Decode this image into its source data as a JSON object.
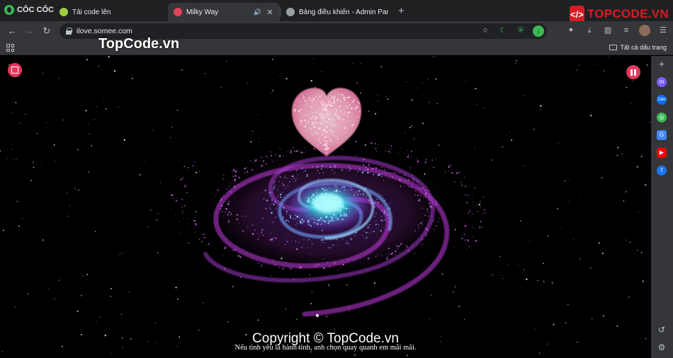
{
  "browser": {
    "brand": "CỐC CỐC",
    "tabs": [
      {
        "title": "Tải code lên",
        "favicon_color": "#9bcf3b"
      },
      {
        "title": "Milky Way",
        "favicon_color": "#e2435a",
        "active": true
      },
      {
        "title": "Bảng điều khiển - Admin Panel",
        "favicon_color": "#9aa0a6"
      }
    ],
    "url": "ilove.somee.com",
    "bookmarks_label": "Tất cả dấu trang",
    "topcode_logo": "TOPCODE.VN"
  },
  "page": {
    "watermark_top": "TopCode.vn",
    "copyright": "Copyright © TopCode.vn",
    "caption": "Nếu tình yêu là hành tinh, anh chọn quay quanh em mãi mãi.",
    "accent_color": "#e23a5b"
  },
  "sidepanel": {
    "icons": [
      "add-icon",
      "messenger-icon",
      "zalo-icon",
      "game-icon",
      "translate-icon",
      "youtube-icon",
      "facebook-icon",
      "history-icon",
      "settings-icon"
    ]
  }
}
